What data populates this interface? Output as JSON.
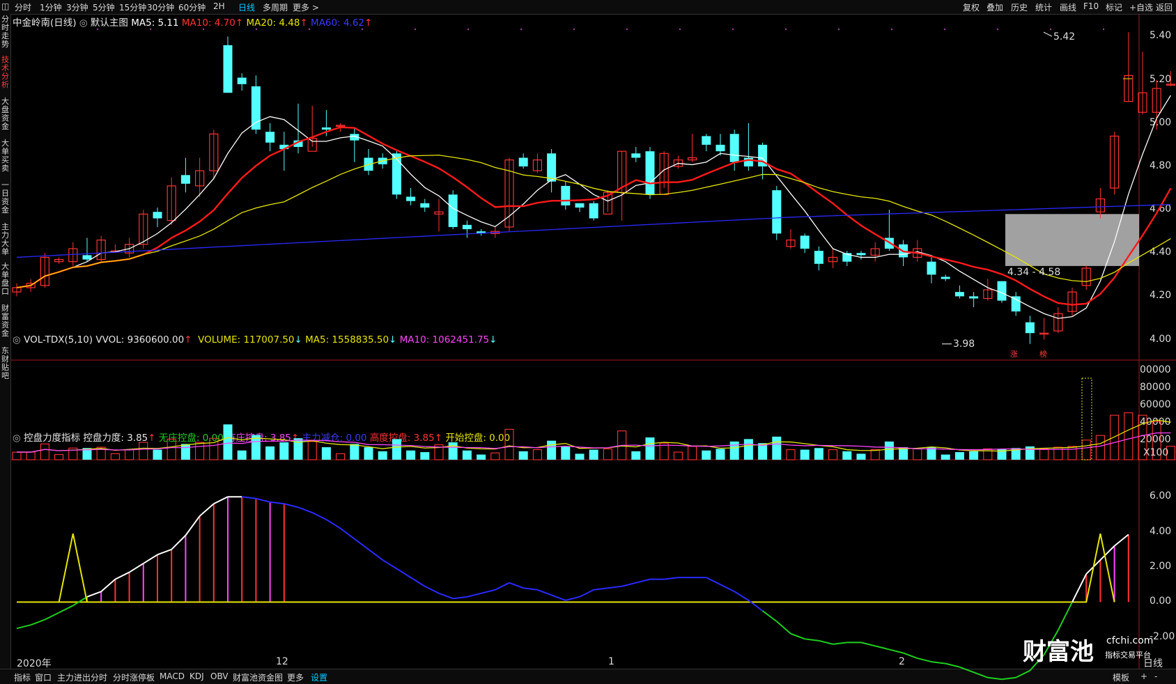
{
  "top_tabs": [
    "分时",
    "1分钟",
    "3分钟",
    "5分钟",
    "15分钟",
    "30分钟",
    "60分钟",
    "2H",
    "日线",
    "多周期",
    "更多 >"
  ],
  "top_tabs_active": "日线",
  "top_right": [
    "复权",
    "叠加",
    "历史",
    "统计",
    "画线",
    "F10",
    "标记",
    "+自选",
    "返回"
  ],
  "left_tabs": [
    "分时走势",
    "技术分析",
    "大盘资金",
    "大单买卖",
    "一日资金",
    "主力大单",
    "大单盘口",
    "财富资金",
    "东财贴吧"
  ],
  "left_tabs_active": "技术分析",
  "bottom_tabs": [
    "指标",
    "窗口",
    "主力进出分时",
    "分时涨停板",
    "MACD",
    "KDJ",
    "OBV",
    "财富池资金图",
    "更多",
    "设置"
  ],
  "bottom_tabs_active": "设置",
  "bottom_right": [
    "模板",
    "+",
    "-"
  ],
  "main_header": {
    "stock": "中金岭南(日线)",
    "theme": "默认主图",
    "ma5": "MA5: 5.11",
    "ma10": "MA10: 4.70",
    "ma20": "MA20: 4.48",
    "ma60": "MA60: 4.62"
  },
  "vol_header": {
    "name": "VOL-TDX(5,10)",
    "vvol": "VVOL: 9360600.00",
    "volume": "VOLUME: 117007.50",
    "ma5": "MA5: 1558835.50",
    "ma10": "MA10: 1062451.75"
  },
  "ind_header": {
    "name": "控盘力度指标",
    "kpld": "控盘力度: 3.85",
    "wzkp": "无庄控盘: 0.00",
    "yzkp": "有庄控盘: 3.85",
    "zljc": "主力减仓: 0.00",
    "gdkp": "高度控盘: 3.85",
    "kskp": "开始控盘: 0.00"
  },
  "annotations": {
    "high": "5.42",
    "low": "3.98",
    "range": "4.34 - 4.58",
    "zhang": "涨",
    "bang": "榜"
  },
  "date_axis": {
    "year": "2020年",
    "m12": "12",
    "m1": "1",
    "m2": "2",
    "right": "日线"
  },
  "watermark": {
    "brand": "财富池",
    "site": "cfchi.com",
    "slogan": "指标交易平台"
  },
  "colors": {
    "up": "#ff3232",
    "down": "#54ffff",
    "ma5": "#ffffff",
    "ma10": "#ff1a1a",
    "ma20": "#e6e600",
    "ma60": "#2a2aff",
    "vol_ma5": "#e6e600",
    "vol_ma10": "#ff44ff",
    "green": "#1ecf1e",
    "magenta": "#ff44ff",
    "blue": "#2a2aff"
  },
  "chart_data": [
    {
      "type": "candlestick",
      "title": "中金岭南(日线)",
      "y_ticks": [
        "5.40",
        "5.20",
        "5.00",
        "4.80",
        "4.60",
        "4.40",
        "4.20",
        "4.00"
      ],
      "ylim": [
        3.96,
        5.44
      ],
      "candles": [
        [
          4.22,
          4.24,
          4.2,
          4.26
        ],
        [
          4.24,
          4.26,
          4.22,
          4.28
        ],
        [
          4.25,
          4.38,
          4.24,
          4.4
        ],
        [
          4.36,
          4.37,
          4.35,
          4.38
        ],
        [
          4.36,
          4.42,
          4.34,
          4.45
        ],
        [
          4.39,
          4.37,
          4.36,
          4.47
        ],
        [
          4.37,
          4.46,
          4.36,
          4.48
        ],
        [
          4.41,
          4.41,
          4.4,
          4.44
        ],
        [
          4.4,
          4.44,
          4.38,
          4.47
        ],
        [
          4.44,
          4.58,
          4.42,
          4.6
        ],
        [
          4.59,
          4.56,
          4.52,
          4.61
        ],
        [
          4.55,
          4.71,
          4.53,
          4.75
        ],
        [
          4.76,
          4.72,
          4.68,
          4.84
        ],
        [
          4.71,
          4.78,
          4.66,
          4.84
        ],
        [
          4.78,
          4.95,
          4.74,
          4.97
        ],
        [
          5.36,
          5.14,
          5.2,
          5.4
        ],
        [
          5.21,
          5.18,
          5.15,
          5.23
        ],
        [
          5.17,
          4.97,
          4.95,
          5.22
        ],
        [
          4.96,
          4.91,
          4.87,
          5.0
        ],
        [
          4.9,
          4.88,
          4.78,
          4.96
        ],
        [
          4.92,
          4.89,
          4.86,
          5.09
        ],
        [
          4.87,
          4.93,
          4.89,
          5.08
        ],
        [
          4.98,
          4.97,
          4.94,
          5.06
        ],
        [
          4.99,
          4.99,
          4.96,
          5.0
        ],
        [
          4.95,
          4.92,
          4.82,
          4.98
        ],
        [
          4.84,
          4.78,
          4.76,
          4.88
        ],
        [
          4.84,
          4.81,
          4.79,
          4.86
        ],
        [
          4.86,
          4.67,
          4.65,
          4.87
        ],
        [
          4.66,
          4.64,
          4.62,
          4.7
        ],
        [
          4.63,
          4.61,
          4.59,
          4.65
        ],
        [
          4.58,
          4.59,
          4.5,
          4.65
        ],
        [
          4.67,
          4.52,
          4.51,
          4.69
        ],
        [
          4.53,
          4.51,
          4.47,
          4.55
        ],
        [
          4.5,
          4.49,
          4.48,
          4.51
        ],
        [
          4.49,
          4.5,
          4.47,
          4.52
        ],
        [
          4.52,
          4.83,
          4.5,
          4.84
        ],
        [
          4.84,
          4.8,
          4.79,
          4.86
        ],
        [
          4.78,
          4.83,
          4.77,
          4.86
        ],
        [
          4.86,
          4.73,
          4.68,
          4.88
        ],
        [
          4.71,
          4.62,
          4.6,
          4.73
        ],
        [
          4.63,
          4.61,
          4.59,
          4.63
        ],
        [
          4.63,
          4.56,
          4.55,
          4.64
        ],
        [
          4.58,
          4.68,
          4.59,
          4.69
        ],
        [
          4.68,
          4.87,
          4.55,
          4.87
        ],
        [
          4.86,
          4.84,
          4.82,
          4.89
        ],
        [
          4.87,
          4.67,
          4.65,
          4.89
        ],
        [
          4.67,
          4.86,
          4.7,
          4.87
        ],
        [
          4.8,
          4.83,
          4.79,
          4.85
        ],
        [
          4.83,
          4.84,
          4.82,
          4.95
        ],
        [
          4.94,
          4.9,
          4.87,
          4.95
        ],
        [
          4.9,
          4.87,
          4.85,
          4.95
        ],
        [
          4.95,
          4.82,
          4.78,
          4.97
        ],
        [
          4.84,
          4.8,
          4.78,
          5.0
        ],
        [
          4.9,
          4.8,
          4.74,
          4.91
        ],
        [
          4.69,
          4.49,
          4.46,
          4.71
        ],
        [
          4.43,
          4.46,
          4.42,
          4.51
        ],
        [
          4.48,
          4.42,
          4.4,
          4.49
        ],
        [
          4.41,
          4.35,
          4.32,
          4.43
        ],
        [
          4.36,
          4.38,
          4.33,
          4.42
        ],
        [
          4.4,
          4.36,
          4.34,
          4.41
        ],
        [
          4.4,
          4.39,
          4.37,
          4.41
        ],
        [
          4.39,
          4.42,
          4.36,
          4.45
        ],
        [
          4.47,
          4.42,
          4.41,
          4.6
        ],
        [
          4.44,
          4.38,
          4.34,
          4.46
        ],
        [
          4.38,
          4.42,
          4.36,
          4.46
        ],
        [
          4.36,
          4.3,
          4.26,
          4.38
        ],
        [
          4.29,
          4.28,
          4.27,
          4.3
        ],
        [
          4.22,
          4.2,
          4.19,
          4.25
        ],
        [
          4.2,
          4.19,
          4.15,
          4.22
        ],
        [
          4.19,
          4.23,
          4.18,
          4.28
        ],
        [
          4.27,
          4.18,
          4.17,
          4.27
        ],
        [
          4.2,
          4.13,
          4.11,
          4.22
        ],
        [
          4.08,
          4.03,
          3.98,
          4.11
        ],
        [
          4.03,
          4.03,
          4.0,
          4.1
        ],
        [
          4.04,
          4.12,
          4.03,
          4.15
        ],
        [
          4.13,
          4.22,
          4.11,
          4.24
        ],
        [
          4.25,
          4.33,
          4.23,
          4.34
        ],
        [
          4.59,
          4.65,
          4.56,
          4.7
        ],
        [
          4.7,
          4.94,
          4.67,
          4.96
        ],
        [
          5.1,
          5.22,
          5.1,
          5.42
        ],
        [
          5.05,
          5.14,
          5.04,
          5.33
        ],
        [
          5.05,
          5.16,
          4.97,
          5.2
        ],
        [
          5.18,
          5.18,
          5.17,
          5.24
        ]
      ],
      "annotations": [
        {
          "x": 79,
          "y": 5.42,
          "label": "5.42"
        },
        {
          "x": 72,
          "y": 3.98,
          "label": "3.98"
        },
        {
          "x": 77,
          "y": 4.34,
          "label": "4.34 - 4.58"
        }
      ]
    },
    {
      "type": "bar",
      "title": "VOL-TDX(5,10)",
      "y_ticks": [
        "00000",
        "80000",
        "60000",
        "40000",
        "20000"
      ],
      "unit": "X100",
      "ylim": [
        0,
        100000
      ]
    },
    {
      "type": "line",
      "title": "控盘力度指标",
      "y_ticks": [
        "6.00",
        "4.00",
        "2.00",
        "0.00",
        "-2.00"
      ],
      "ylim": [
        -3,
        7
      ],
      "series": [
        {
          "name": "控盘力度",
          "values": [
            -1.5,
            -1.3,
            -1.0,
            -0.6,
            -0.2,
            0.3,
            0.6,
            1.3,
            1.7,
            2.2,
            2.7,
            3.0,
            3.8,
            4.9,
            5.6,
            6.0,
            6.0,
            5.9,
            5.7,
            5.6,
            5.4,
            5.1,
            4.7,
            4.2,
            3.6,
            3.0,
            2.4,
            1.9,
            1.4,
            0.9,
            0.5,
            0.2,
            0.3,
            0.5,
            0.7,
            1.1,
            0.8,
            0.7,
            0.4,
            0.1,
            0.3,
            0.7,
            0.8,
            0.9,
            1.1,
            1.3,
            1.3,
            1.4,
            1.4,
            1.4,
            1.0,
            0.6,
            0.1,
            -0.5,
            -1.1,
            -1.8,
            -2.1,
            -2.2,
            -2.4,
            -2.3,
            -2.3,
            -2.5,
            -2.7,
            -2.9,
            -3.2,
            -3.4,
            -3.5,
            -3.7,
            -4.0,
            -4.3,
            -4.4,
            -4.3,
            -3.9,
            -3.0,
            -1.6,
            0.0,
            1.6,
            2.4,
            3.2,
            3.85
          ]
        }
      ]
    }
  ]
}
